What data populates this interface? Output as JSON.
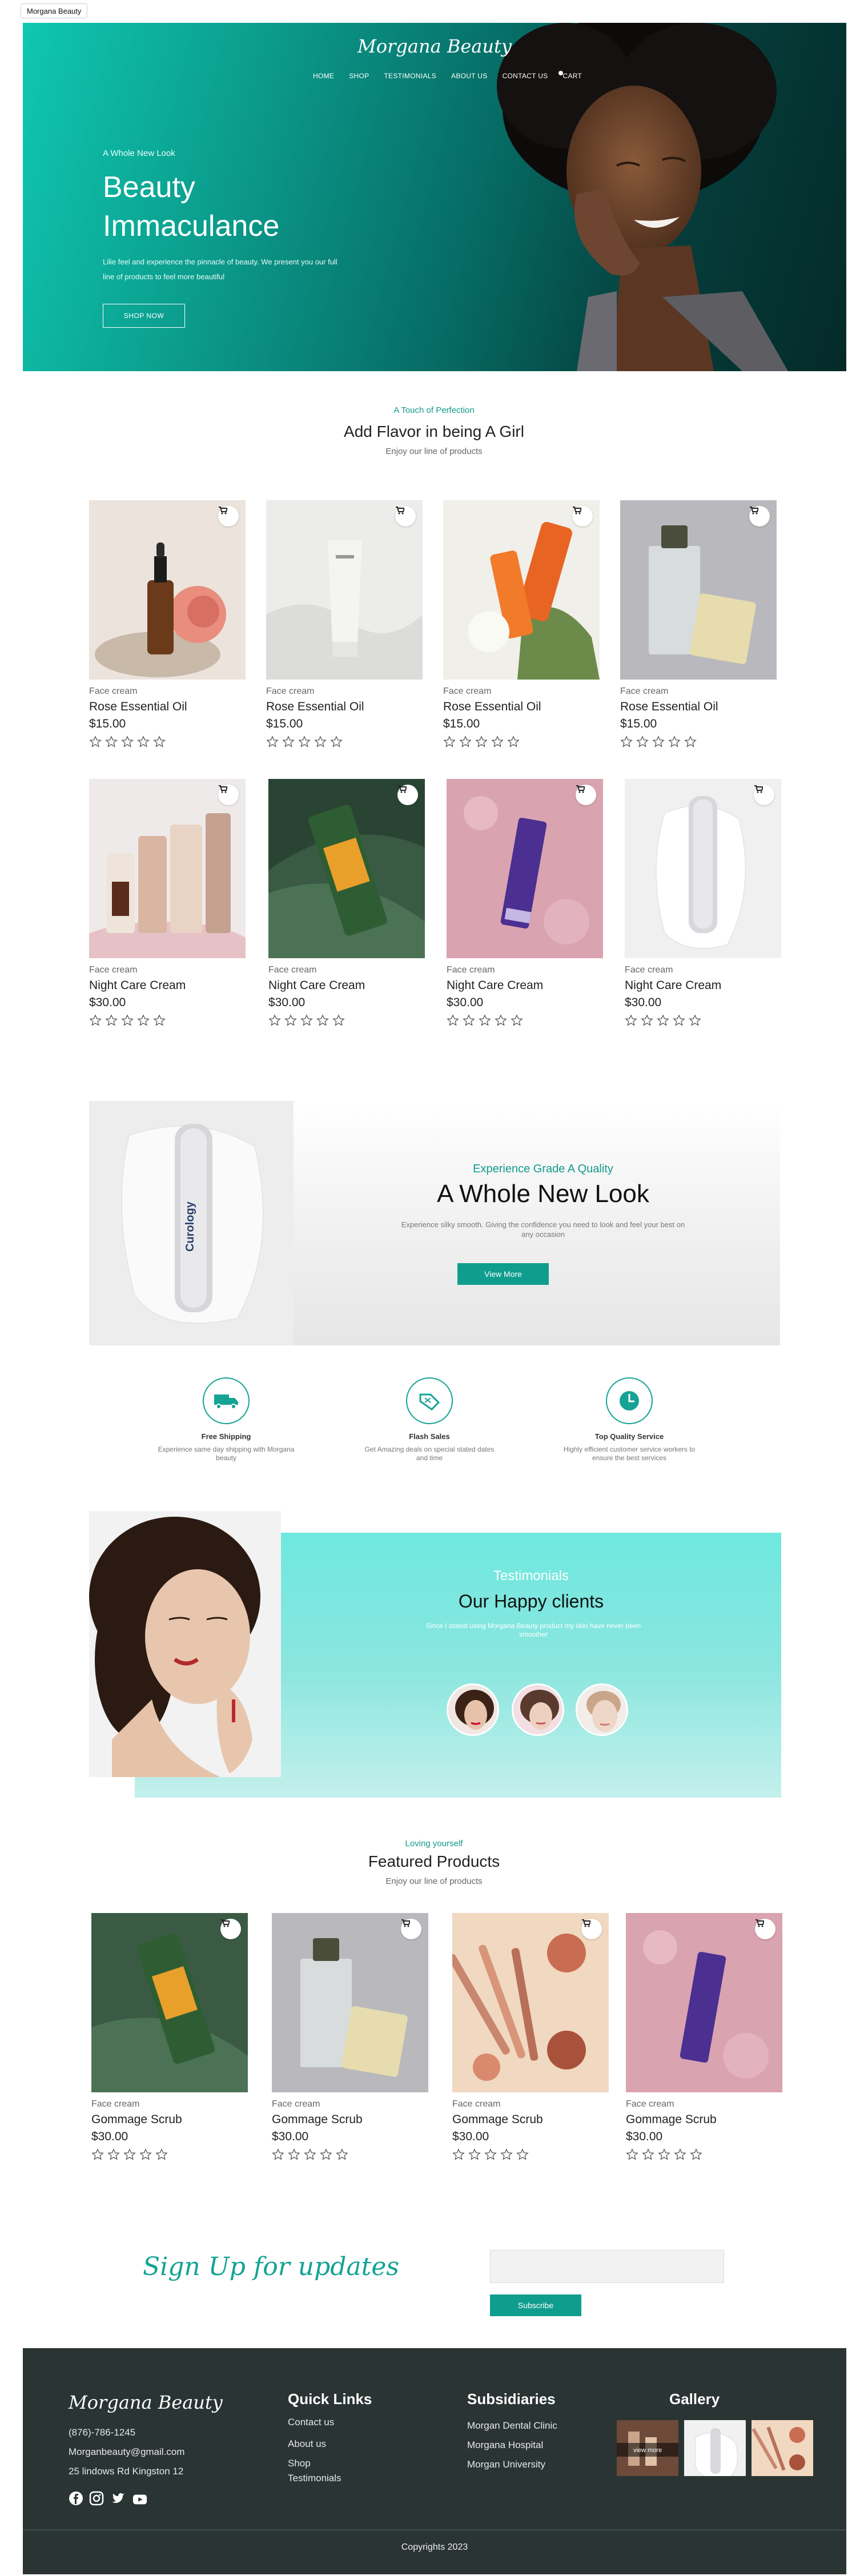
{
  "browser_tab": {
    "title": "Morgana Beauty"
  },
  "brand": "Morgana Beauty",
  "nav": [
    "HOME",
    "SHOP",
    "TESTIMONIALS",
    "ABOUT US",
    "CONTACT US",
    "CART"
  ],
  "hero": {
    "kicker": "A Whole New Look",
    "title": "Beauty Immaculance",
    "text": "Lilie feel and experience the pinnacle of beauty. We present you our full line of products to feel more beautiful",
    "button": "SHOP NOW"
  },
  "flavor_section": {
    "kicker": "A Touch of Perfection",
    "title": "Add Flavor in being A Girl",
    "subtitle": "Enjoy our line of products"
  },
  "products_row1": [
    {
      "category": "Face cream",
      "name": "Rose Essential Oil",
      "price": "$15.00",
      "rating": 0
    },
    {
      "category": "Face cream",
      "name": "Rose Essential Oil",
      "price": "$15.00",
      "rating": 0
    },
    {
      "category": "Face cream",
      "name": "Rose Essential Oil",
      "price": "$15.00",
      "rating": 0
    },
    {
      "category": "Face cream",
      "name": "Rose Essential Oil",
      "price": "$15.00",
      "rating": 0
    }
  ],
  "products_row2": [
    {
      "category": "Face cream",
      "name": "Night Care Cream",
      "price": "$30.00",
      "rating": 0
    },
    {
      "category": "Face cream",
      "name": "Night Care Cream",
      "price": "$30.00",
      "rating": 0
    },
    {
      "category": "Face cream",
      "name": "Night Care Cream",
      "price": "$30.00",
      "rating": 0
    },
    {
      "category": "Face cream",
      "name": "Night Care Cream",
      "price": "$30.00",
      "rating": 0
    }
  ],
  "promo": {
    "product_label": "Curology",
    "kicker": "Experience Grade A Quality",
    "title": "A Whole New Look",
    "text": "Experience silky smooth. Giving the confidence you need to look and feel your best on any occasion",
    "button": "View More"
  },
  "features": [
    {
      "icon": "truck-icon",
      "title": "Free Shipping",
      "desc": "Experience same day shipping with Morgana beauty"
    },
    {
      "icon": "tag-icon",
      "title": "Flash Sales",
      "desc": "Get Amazing deals on special stated dates and time"
    },
    {
      "icon": "clock-icon",
      "title": "Top Quality Service",
      "desc": "Highly efficient customer service workers to ensure the best services"
    }
  ],
  "testimonials": {
    "kicker": "Testimonials",
    "title": "Our Happy clients",
    "subtitle": "Since I stated using Morgana Beauty product my skin have never been smoother"
  },
  "featured": {
    "kicker": "Loving yourself",
    "title": "Featured Products",
    "subtitle": "Enjoy our line of products",
    "products": [
      {
        "category": "Face cream",
        "name": "Gommage Scrub",
        "price": "$30.00",
        "rating": 0
      },
      {
        "category": "Face cream",
        "name": "Gommage Scrub",
        "price": "$30.00",
        "rating": 0
      },
      {
        "category": "Face cream",
        "name": "Gommage Scrub",
        "price": "$30.00",
        "rating": 0
      },
      {
        "category": "Face cream",
        "name": "Gommage Scrub",
        "price": "$30.00",
        "rating": 0
      }
    ]
  },
  "signup": {
    "title": "Sign Up for updates",
    "placeholder": "",
    "button": "Subscribe"
  },
  "footer": {
    "brand": "Morgana Beauty",
    "phone": "(876)-786-1245",
    "email": "Morganbeauty@gmail.com",
    "address": "25 lindows Rd Kingston 12",
    "social": [
      "facebook-icon",
      "instagram-icon",
      "twitter-icon",
      "youtube-icon"
    ],
    "quick_links_title": "Quick Links",
    "quick_links": [
      "Contact us",
      "About us",
      "Shop",
      "Testimonials"
    ],
    "subsidiaries_title": "Subsidiaries",
    "subsidiaries": [
      "Morgan Dental Clinic",
      "Morgana Hospital",
      "Morgan University"
    ],
    "gallery_title": "Gallery",
    "gallery_overlay": "view more",
    "copyright": "Copyrights 2023"
  },
  "colors": {
    "accent": "#0f9d8e",
    "footer_bg": "#293433",
    "hero_start": "#0fc7b0",
    "hero_end": "#042a28"
  }
}
